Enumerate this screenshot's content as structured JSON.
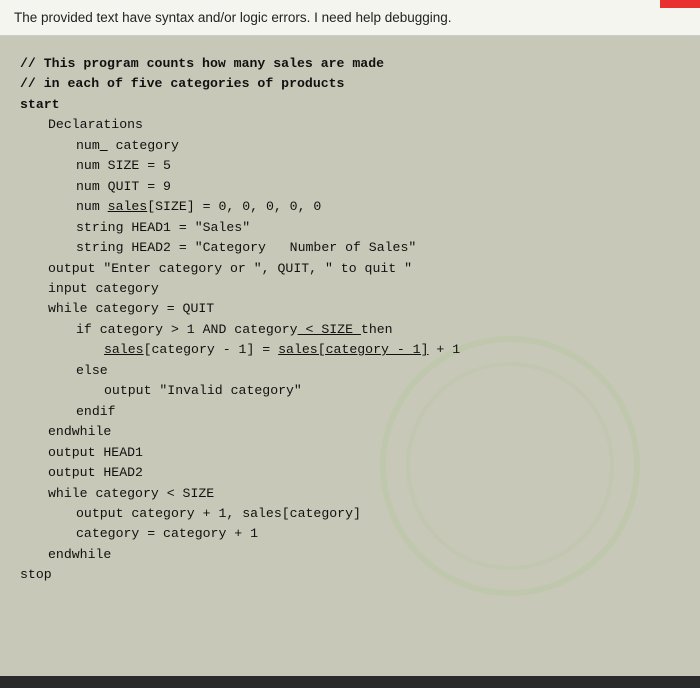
{
  "topbar": {
    "text": "he provided text have syntax and/or logic errors. I need help debugging."
  },
  "code": {
    "lines": [
      {
        "indent": 0,
        "text": "// This program counts how many sales are made",
        "bold": true
      },
      {
        "indent": 0,
        "text": "// in each of five categories of products",
        "bold": true
      },
      {
        "indent": 0,
        "text": "start",
        "bold": false
      },
      {
        "indent": 1,
        "text": "Declarations",
        "bold": false
      },
      {
        "indent": 2,
        "text": "num category",
        "bold": false
      },
      {
        "indent": 2,
        "text": "num SIZE = 5",
        "bold": false
      },
      {
        "indent": 2,
        "text": "num QUIT = 9",
        "bold": false
      },
      {
        "indent": 2,
        "text": "num sales[SIZE] = 0, 0, 0, 0, 0",
        "bold": false,
        "underline_word": "sales"
      },
      {
        "indent": 2,
        "text": "string HEAD1 = \"Sales\"",
        "bold": false
      },
      {
        "indent": 2,
        "text": "string HEAD2 = \"Category   Number of Sales\"",
        "bold": false
      },
      {
        "indent": 1,
        "text": "output \"Enter category or \", QUIT, \" to quit \"",
        "bold": false
      },
      {
        "indent": 1,
        "text": "input category",
        "bold": false
      },
      {
        "indent": 1,
        "text": "while category = QUIT",
        "bold": false
      },
      {
        "indent": 2,
        "text": "if category > 1 AND category < SIZE then",
        "bold": false
      },
      {
        "indent": 3,
        "text": "sales[category - 1] = sales[category - 1] + 1",
        "bold": false,
        "underline_word": "sales"
      },
      {
        "indent": 2,
        "text": "else",
        "bold": false
      },
      {
        "indent": 3,
        "text": "output \"Invalid category\"",
        "bold": false
      },
      {
        "indent": 2,
        "text": "endif",
        "bold": false
      },
      {
        "indent": 1,
        "text": "endwhile",
        "bold": false
      },
      {
        "indent": 1,
        "text": "output HEAD1",
        "bold": false
      },
      {
        "indent": 1,
        "text": "output HEAD2",
        "bold": false
      },
      {
        "indent": 1,
        "text": "while category < SIZE",
        "bold": false
      },
      {
        "indent": 2,
        "text": "output category + 1, sales[category]",
        "bold": false
      },
      {
        "indent": 2,
        "text": "category = category + 1",
        "bold": false
      },
      {
        "indent": 1,
        "text": "endwhile",
        "bold": false
      },
      {
        "indent": 0,
        "text": "stop",
        "bold": false
      }
    ]
  }
}
